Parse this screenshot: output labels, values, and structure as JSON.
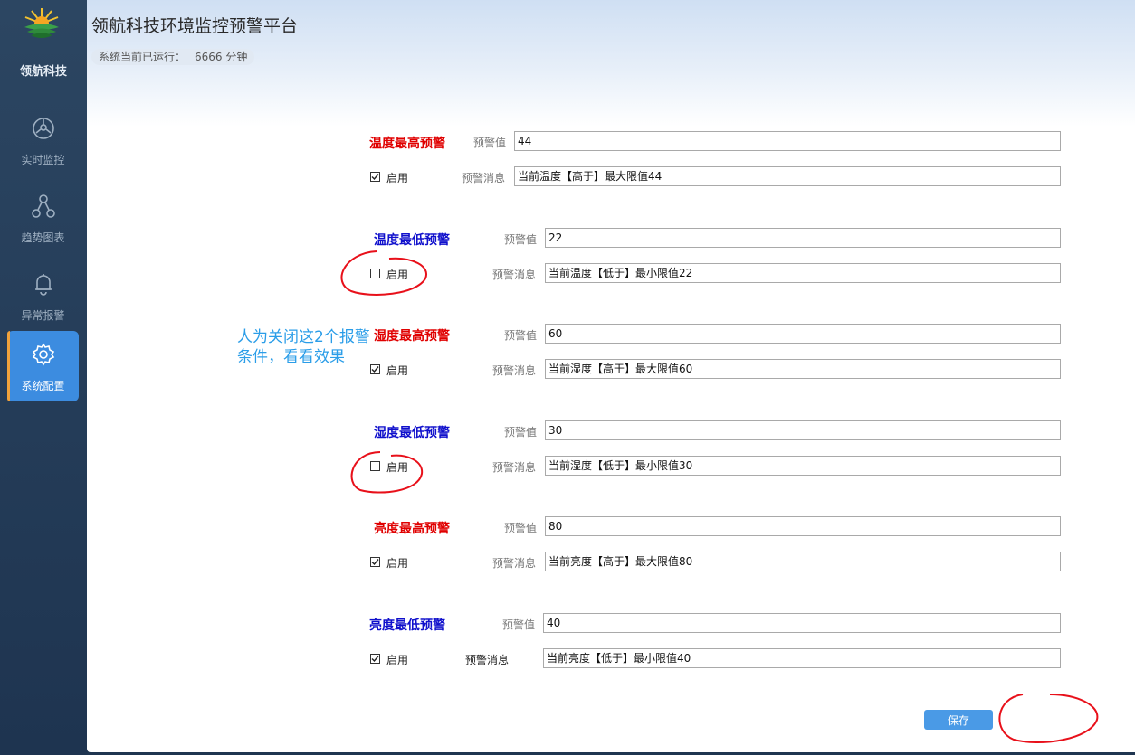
{
  "app": {
    "title": "领航科技环境监控预警平台",
    "brand": "领航科技",
    "status_label": "系统当前已运行：",
    "status_value": "6666 分钟"
  },
  "sidebar": {
    "items": [
      {
        "label": "实时监控",
        "icon": "monitor-hub-icon",
        "active": false
      },
      {
        "label": "趋势图表",
        "icon": "nodes-icon",
        "active": false
      },
      {
        "label": "异常报警",
        "icon": "bell-icon",
        "active": false
      },
      {
        "label": "系统配置",
        "icon": "gear-icon",
        "active": true
      }
    ]
  },
  "alerts": [
    {
      "title": "温度最高预警",
      "color": "#e00000",
      "value_label": "预警值",
      "value": "44",
      "enabled": true,
      "enable_label": "启用",
      "msg_label": "预警消息",
      "message": "当前温度【高于】最大限值44"
    },
    {
      "title": "温度最低预警",
      "color": "#1010cc",
      "value_label": "预警值",
      "value": "22",
      "enabled": false,
      "enable_label": "启用",
      "msg_label": "预警消息",
      "message": "当前温度【低于】最小限值22"
    },
    {
      "title": "湿度最高预警",
      "color": "#e00000",
      "value_label": "预警值",
      "value": "60",
      "enabled": true,
      "enable_label": "启用",
      "msg_label": "预警消息",
      "message": "当前湿度【高于】最大限值60"
    },
    {
      "title": "湿度最低预警",
      "color": "#1010cc",
      "value_label": "预警值",
      "value": "30",
      "enabled": false,
      "enable_label": "启用",
      "msg_label": "预警消息",
      "message": "当前湿度【低于】最小限值30"
    },
    {
      "title": "亮度最高预警",
      "color": "#e00000",
      "value_label": "预警值",
      "value": "80",
      "enabled": true,
      "enable_label": "启用",
      "msg_label": "预警消息",
      "message": "当前亮度【高于】最大限值80"
    },
    {
      "title": "亮度最低预警",
      "color": "#1010cc",
      "value_label": "预警值",
      "value": "40",
      "enabled": true,
      "enable_label": "启用",
      "msg_label": "预警消息",
      "message": "当前亮度【低于】最小限值40"
    }
  ],
  "save_label": "保存",
  "annotation_text_line1": "人为关闭这2个报警",
  "annotation_text_line2": "条件，看看效果",
  "colors": {
    "accent": "#3c8ce0",
    "annotation": "#e8101a",
    "note": "#2a9de8"
  }
}
